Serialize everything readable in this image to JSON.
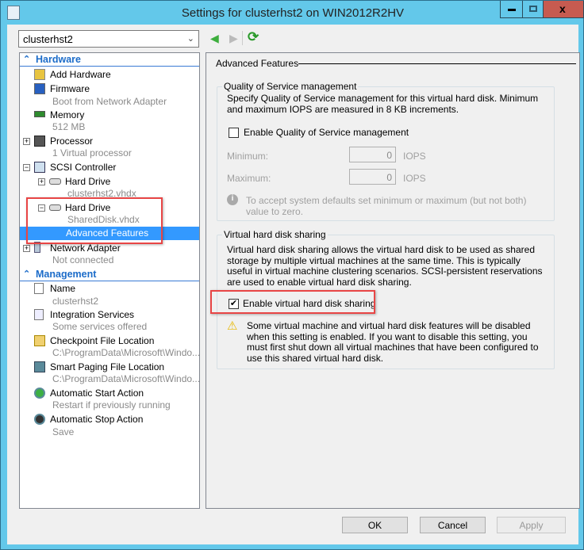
{
  "window": {
    "title": "Settings for clusterhst2 on WIN2012R2HV",
    "controls": {
      "minimize": "minimize-icon",
      "maximize": "maximize-icon",
      "close": "close-icon"
    },
    "close_color": "#c75b50",
    "titlebar_color": "#63c8ea"
  },
  "vm_selector": {
    "value": "clusterhst2"
  },
  "nav": {
    "back": "back-arrow-icon",
    "forward": "forward-arrow-icon",
    "refresh": "refresh-icon"
  },
  "tree": {
    "hardware_header": "Hardware",
    "add_hardware": "Add Hardware",
    "firmware": {
      "label": "Firmware",
      "sub": "Boot from Network Adapter"
    },
    "memory": {
      "label": "Memory",
      "sub": "512 MB"
    },
    "processor": {
      "label": "Processor",
      "sub": "1 Virtual processor"
    },
    "scsi": {
      "label": "SCSI Controller"
    },
    "hd1": {
      "label": "Hard Drive",
      "sub": "clusterhst2.vhdx"
    },
    "hd2": {
      "label": "Hard Drive",
      "sub": "SharedDisk.vhdx"
    },
    "advanced": "Advanced Features",
    "network": {
      "label": "Network Adapter",
      "sub": "Not connected"
    },
    "management_header": "Management",
    "name": {
      "label": "Name",
      "sub": "clusterhst2"
    },
    "integration": {
      "label": "Integration Services",
      "sub": "Some services offered"
    },
    "checkpoint": {
      "label": "Checkpoint File Location",
      "sub": "C:\\ProgramData\\Microsoft\\Windo..."
    },
    "paging": {
      "label": "Smart Paging File Location",
      "sub": "C:\\ProgramData\\Microsoft\\Windo..."
    },
    "autostart": {
      "label": "Automatic Start Action",
      "sub": "Restart if previously running"
    },
    "autostop": {
      "label": "Automatic Stop Action",
      "sub": "Save"
    }
  },
  "main": {
    "section_title": "Advanced Features",
    "qos": {
      "title": "Quality of Service management",
      "desc": "Specify Quality of Service management for this virtual hard disk. Minimum and maximum IOPS are measured in 8 KB increments.",
      "enable_label": "Enable Quality of Service management",
      "enabled": false,
      "min_label": "Minimum:",
      "min_value": "0",
      "max_label": "Maximum:",
      "max_value": "0",
      "unit": "IOPS",
      "info": "To accept system defaults set minimum or maximum (but not both) value to zero."
    },
    "sharing": {
      "title": "Virtual hard disk sharing",
      "desc": "Virtual hard disk sharing allows the virtual hard disk to be used as shared storage by multiple virtual machines at the same time. This is typically useful in virtual machine clustering scenarios. SCSI-persistent reservations are used to enable virtual hard disk sharing.",
      "enable_label": "Enable virtual hard disk sharing",
      "enabled": true,
      "warning": "Some virtual machine and virtual hard disk features will be disabled when this setting is enabled. If you want to disable this setting, you must first shut down all virtual machines that have been configured to use this shared virtual hard disk."
    }
  },
  "buttons": {
    "ok": "OK",
    "cancel": "Cancel",
    "apply": "Apply"
  },
  "highlight_color": "#e84545"
}
